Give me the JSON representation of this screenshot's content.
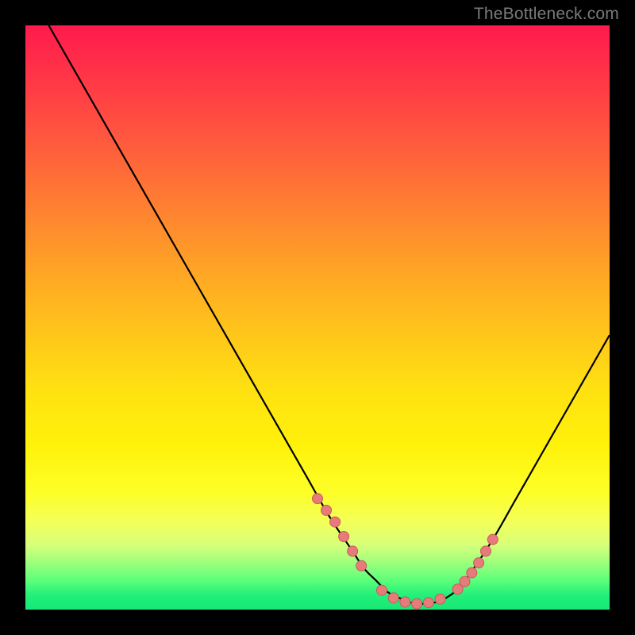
{
  "watermark": {
    "text": "TheBottleneck.com"
  },
  "colors": {
    "background": "#000000",
    "curve": "#000000",
    "marker_fill": "#e77a7a",
    "marker_stroke": "#c95b5b",
    "gradient_top": "#ff1a4d",
    "gradient_bottom": "#17e876"
  },
  "chart_data": {
    "type": "line",
    "title": "",
    "xlabel": "",
    "ylabel": "",
    "xlim": [
      0,
      100
    ],
    "ylim": [
      0,
      100
    ],
    "grid": false,
    "legend": false,
    "series": [
      {
        "name": "bottleneck-curve",
        "x": [
          4,
          8,
          12,
          16,
          20,
          24,
          28,
          32,
          36,
          40,
          44,
          48,
          52,
          56,
          58,
          60,
          62,
          64,
          66,
          68,
          70,
          72,
          74,
          76,
          80,
          84,
          88,
          92,
          96,
          100
        ],
        "y": [
          100,
          93,
          86,
          79,
          72,
          65,
          58,
          51,
          44,
          37,
          30,
          23,
          16,
          10,
          7,
          5,
          3,
          2,
          1.2,
          1,
          1.2,
          2,
          3.5,
          6,
          12,
          19,
          26,
          33,
          40,
          47
        ]
      }
    ],
    "markers": [
      {
        "name": "left-cluster",
        "x": [
          50,
          51.5,
          53,
          54.5,
          56,
          57.5
        ],
        "y": [
          19,
          17,
          15,
          12.5,
          10,
          7.5
        ]
      },
      {
        "name": "valley",
        "x": [
          61,
          63,
          65,
          67,
          69,
          71
        ],
        "y": [
          3.3,
          2,
          1.3,
          1,
          1.2,
          1.8
        ]
      },
      {
        "name": "right-cluster",
        "x": [
          74,
          75.2,
          76.4,
          77.6,
          78.8,
          80
        ],
        "y": [
          3.5,
          4.8,
          6.3,
          8,
          10,
          12
        ]
      }
    ]
  }
}
